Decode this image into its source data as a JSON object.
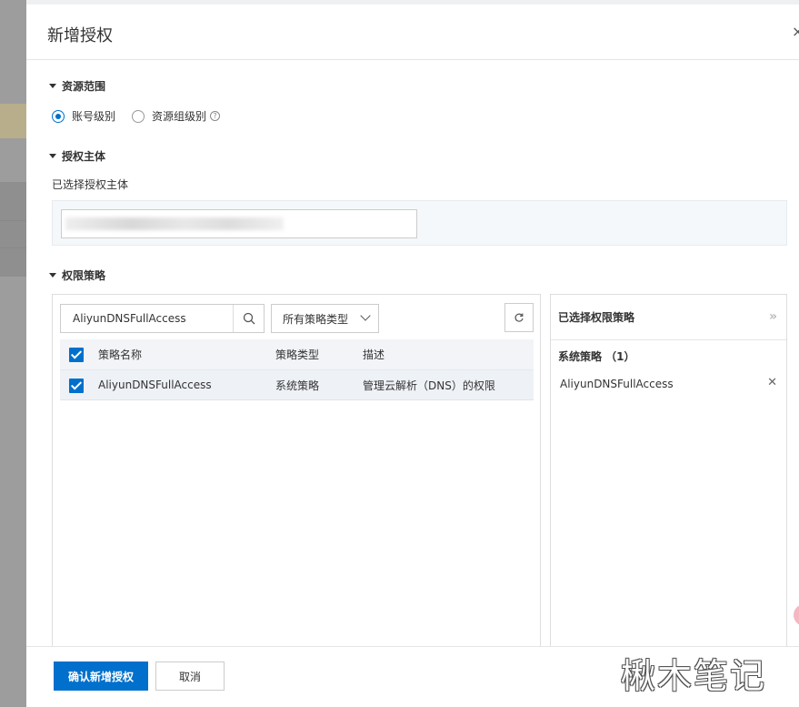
{
  "drawer": {
    "title": "新增授权",
    "close": "×"
  },
  "resource_scope": {
    "heading": "资源范围",
    "options": [
      {
        "label": "账号级别",
        "selected": true
      },
      {
        "label": "资源组级别",
        "selected": false
      }
    ],
    "help_icon": "question-circle-icon"
  },
  "principal": {
    "heading": "授权主体",
    "selected_label": "已选择授权主体"
  },
  "policies": {
    "heading": "权限策略",
    "search_value": "AliyunDNSFullAccess",
    "type_filter": "所有策略类型",
    "table": {
      "headers": [
        "策略名称",
        "策略类型",
        "描述"
      ],
      "rows": [
        {
          "name": "AliyunDNSFullAccess",
          "type": "系统策略",
          "desc": "管理云解析（DNS）的权限",
          "checked": true
        }
      ]
    }
  },
  "selected_panel": {
    "title": "已选择权限策略",
    "group": "系统策略 （1）",
    "items": [
      "AliyunDNSFullAccess"
    ]
  },
  "footer": {
    "confirm": "确认新增授权",
    "cancel": "取消"
  },
  "watermark": "楸木笔记",
  "colors": {
    "primary": "#0070cc"
  }
}
